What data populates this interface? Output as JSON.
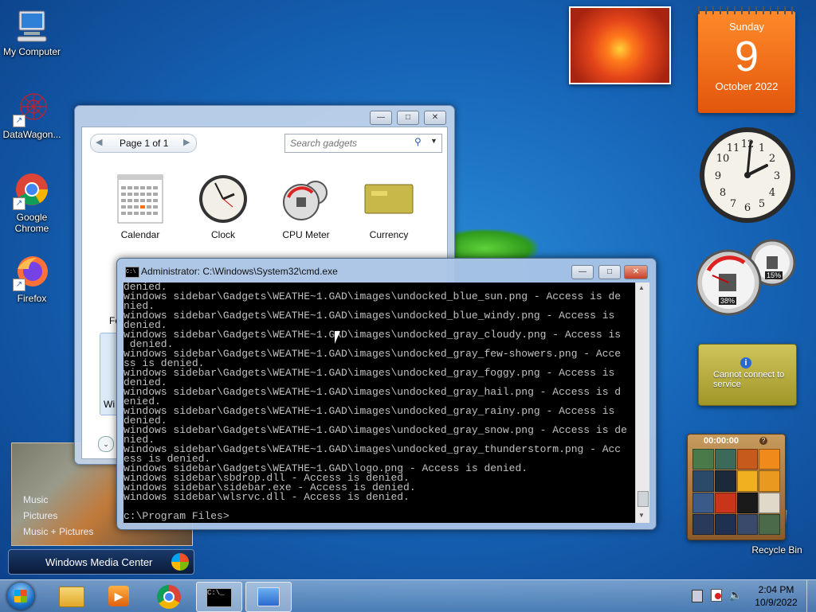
{
  "desktop_icons": [
    {
      "label": "My Computer",
      "icon": "computer-icon"
    },
    {
      "label": "DataWagon...",
      "icon": "datawagon-icon"
    },
    {
      "label": "Google Chrome",
      "icon": "chrome-icon"
    },
    {
      "label": "Firefox",
      "icon": "firefox-icon"
    },
    {
      "label": "Recycle Bin",
      "icon": "recycle-bin-icon"
    }
  ],
  "gadget_gallery": {
    "page": "Page 1 of 1",
    "search_placeholder": "Search gadgets",
    "gadgets": [
      {
        "label": "Calendar",
        "icon": "calendar-gadget-icon"
      },
      {
        "label": "Clock",
        "icon": "clock-gadget-icon"
      },
      {
        "label": "CPU Meter",
        "icon": "cpu-meter-gadget-icon"
      },
      {
        "label": "Currency",
        "icon": "currency-gadget-icon"
      }
    ],
    "partial_labels": [
      "Fe",
      "Wi"
    ]
  },
  "cmd": {
    "title": "Administrator: C:\\Windows\\System32\\cmd.exe",
    "lines": [
      "denied.",
      "windows sidebar\\Gadgets\\WEATHE~1.GAD\\images\\undocked_blue_sun.png - Access is de",
      "nied.",
      "windows sidebar\\Gadgets\\WEATHE~1.GAD\\images\\undocked_blue_windy.png - Access is",
      "denied.",
      "windows sidebar\\Gadgets\\WEATHE~1.GAD\\images\\undocked_gray_cloudy.png - Access is",
      " denied.",
      "windows sidebar\\Gadgets\\WEATHE~1.GAD\\images\\undocked_gray_few-showers.png - Acce",
      "ss is denied.",
      "windows sidebar\\Gadgets\\WEATHE~1.GAD\\images\\undocked_gray_foggy.png - Access is",
      "denied.",
      "windows sidebar\\Gadgets\\WEATHE~1.GAD\\images\\undocked_gray_hail.png - Access is d",
      "enied.",
      "windows sidebar\\Gadgets\\WEATHE~1.GAD\\images\\undocked_gray_rainy.png - Access is",
      "denied.",
      "windows sidebar\\Gadgets\\WEATHE~1.GAD\\images\\undocked_gray_snow.png - Access is de",
      "nied.",
      "windows sidebar\\Gadgets\\WEATHE~1.GAD\\images\\undocked_gray_thunderstorm.png - Acc",
      "ess is denied.",
      "windows sidebar\\Gadgets\\WEATHE~1.GAD\\logo.png - Access is denied.",
      "windows sidebar\\sbdrop.dll - Access is denied.",
      "windows sidebar\\sidebar.exe - Access is denied.",
      "windows sidebar\\wlsrvc.dll - Access is denied.",
      "",
      "c:\\Program Files>"
    ]
  },
  "calendar_gadget": {
    "weekday": "Sunday",
    "day": "9",
    "month_year": "October 2022"
  },
  "cpu_gadget": {
    "cpu": "38%",
    "memory": "15%"
  },
  "currency_gadget": {
    "message": "Cannot connect to service"
  },
  "puzzle_gadget": {
    "timer": "00:00:00"
  },
  "media_center": {
    "items": [
      "Music",
      "Pictures",
      "Music + Pictures"
    ],
    "title": "Windows Media Center"
  },
  "taskbar": {
    "time": "2:04 PM",
    "date": "10/9/2022",
    "apps": [
      "explorer-icon",
      "media-player-icon",
      "chrome-icon",
      "cmd-icon",
      "gadget-icon"
    ]
  },
  "colors": {
    "accent_orange": "#e8651a",
    "cmd_bg": "#000000",
    "cmd_text": "#c0c0c0"
  }
}
